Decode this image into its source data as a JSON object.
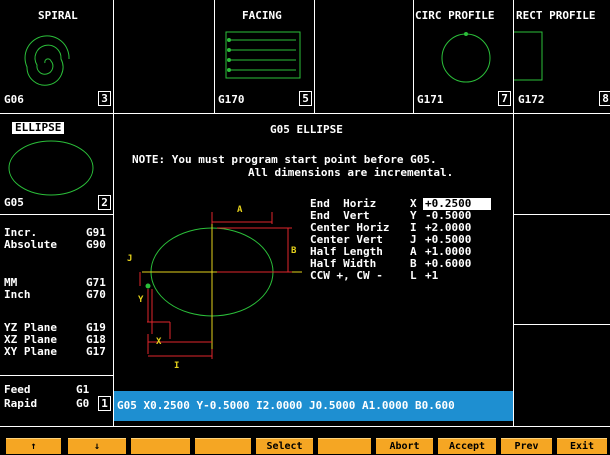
{
  "tiles": [
    {
      "title": "SPIRAL",
      "code": "G06",
      "num": "3"
    },
    {
      "title": "FACING",
      "code": "G170",
      "num": "5"
    },
    {
      "title": "CIRC PROFILE",
      "code": "G171",
      "num": "7"
    },
    {
      "title": "RECT PROFILE",
      "code": "G172",
      "num": "8"
    },
    {
      "title": "ELLIPSE",
      "code": "G05",
      "num": "2"
    }
  ],
  "dialog": {
    "title": "G05 ELLIPSE",
    "note_line1": "NOTE: You must program start point before G05.",
    "note_line2": "All dimensions are incremental."
  },
  "params": [
    {
      "label": "End  Horiz",
      "letter": "X",
      "value": "+0.2500"
    },
    {
      "label": "End  Vert",
      "letter": "Y",
      "value": "-0.5000"
    },
    {
      "label": "Center Horiz",
      "letter": "I",
      "value": "+2.0000"
    },
    {
      "label": "Center Vert",
      "letter": "J",
      "value": "+0.5000"
    },
    {
      "label": "Half Length",
      "letter": "A",
      "value": "+1.0000"
    },
    {
      "label": "Half Width",
      "letter": "B",
      "value": "+0.6000"
    },
    {
      "label": "CCW +, CW -",
      "letter": "L",
      "value": "+1"
    }
  ],
  "diagram_labels": {
    "a": "A",
    "b": "B",
    "j": "J",
    "y": "Y",
    "x": "X",
    "i": "I"
  },
  "modes": [
    {
      "label": "Incr.",
      "code": "G91"
    },
    {
      "label": "Absolute",
      "code": "G90"
    },
    {
      "label": "MM",
      "code": "G71"
    },
    {
      "label": "Inch",
      "code": "G70"
    },
    {
      "label": "YZ Plane",
      "code": "G19"
    },
    {
      "label": "XZ Plane",
      "code": "G18"
    },
    {
      "label": "XY Plane",
      "code": "G17"
    },
    {
      "label": "Feed",
      "code": "G1"
    },
    {
      "label": "Rapid",
      "code": "G0"
    }
  ],
  "rapid_num": "1",
  "status_line": "G05 X0.2500 Y-0.5000 I2.0000 J0.5000 A1.0000 B0.600",
  "fkeys": [
    "↑",
    "↓",
    "",
    "",
    "Select",
    "",
    "Abort",
    "Accept",
    "Prev",
    "Exit"
  ],
  "colors": {
    "accent": "#1e8fd1",
    "fkey": "#f5a623",
    "line": "#2bbf3a",
    "dim": "#e0262b",
    "axis": "#e5d21c"
  }
}
